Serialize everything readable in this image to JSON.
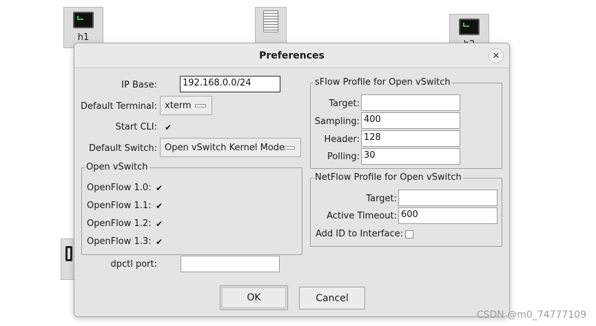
{
  "canvas": {
    "host_h1": "h1",
    "host_h2": "h2"
  },
  "dialog": {
    "title": "Preferences",
    "close_glyph": "✕"
  },
  "general": {
    "ip_base_label": "IP Base:",
    "ip_base_value": "192.168.0.0/24",
    "default_terminal_label": "Default Terminal:",
    "default_terminal_value": "xterm",
    "start_cli_label": "Start CLI:",
    "start_cli_checked": true,
    "default_switch_label": "Default Switch:",
    "default_switch_value": "Open vSwitch Kernel Mode",
    "dpctl_port_label": "dpctl port:",
    "dpctl_port_value": ""
  },
  "openvswitch": {
    "group_title": "Open vSwitch",
    "options": [
      {
        "label": "OpenFlow 1.0:",
        "checked": true
      },
      {
        "label": "OpenFlow 1.1:",
        "checked": true
      },
      {
        "label": "OpenFlow 1.2:",
        "checked": true
      },
      {
        "label": "OpenFlow 1.3:",
        "checked": true
      }
    ]
  },
  "sflow": {
    "group_title": "sFlow Profile for Open vSwitch",
    "target_label": "Target:",
    "target_value": "",
    "sampling_label": "Sampling:",
    "sampling_value": "400",
    "header_label": "Header:",
    "header_value": "128",
    "polling_label": "Polling:",
    "polling_value": "30"
  },
  "netflow": {
    "group_title": "NetFlow Profile for Open vSwitch",
    "target_label": "Target:",
    "target_value": "",
    "active_timeout_label": "Active Timeout:",
    "active_timeout_value": "600",
    "add_id_label": "Add ID to Interface:",
    "add_id_checked": false
  },
  "buttons": {
    "ok_label": "OK",
    "cancel_label": "Cancel"
  },
  "check_glyph": "✔",
  "watermark": "CSDN @m0_74777109"
}
